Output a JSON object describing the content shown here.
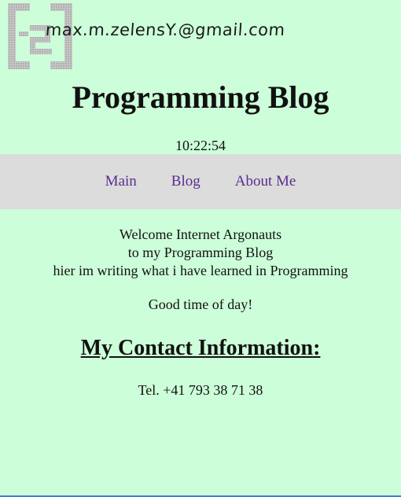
{
  "header": {
    "email": "max.m.zelensY.@gmail.com",
    "title": "Programming Blog",
    "clock": "10:22:54"
  },
  "nav": {
    "items": [
      {
        "label": "Main"
      },
      {
        "label": "Blog"
      },
      {
        "label": "About Me"
      }
    ]
  },
  "main": {
    "intro_lines": [
      "Welcome Internet Argonauts",
      "to my Programming Blog",
      "hier im writing what i have learned in Programming"
    ],
    "greeting": "Good time of day!",
    "contact_heading": "My Contact Information:",
    "phone": "Tel. +41 793 38 71 38"
  },
  "colors": {
    "background": "#ccffd9",
    "nav_background": "#dcdcdc",
    "link": "#5b2d8e"
  }
}
